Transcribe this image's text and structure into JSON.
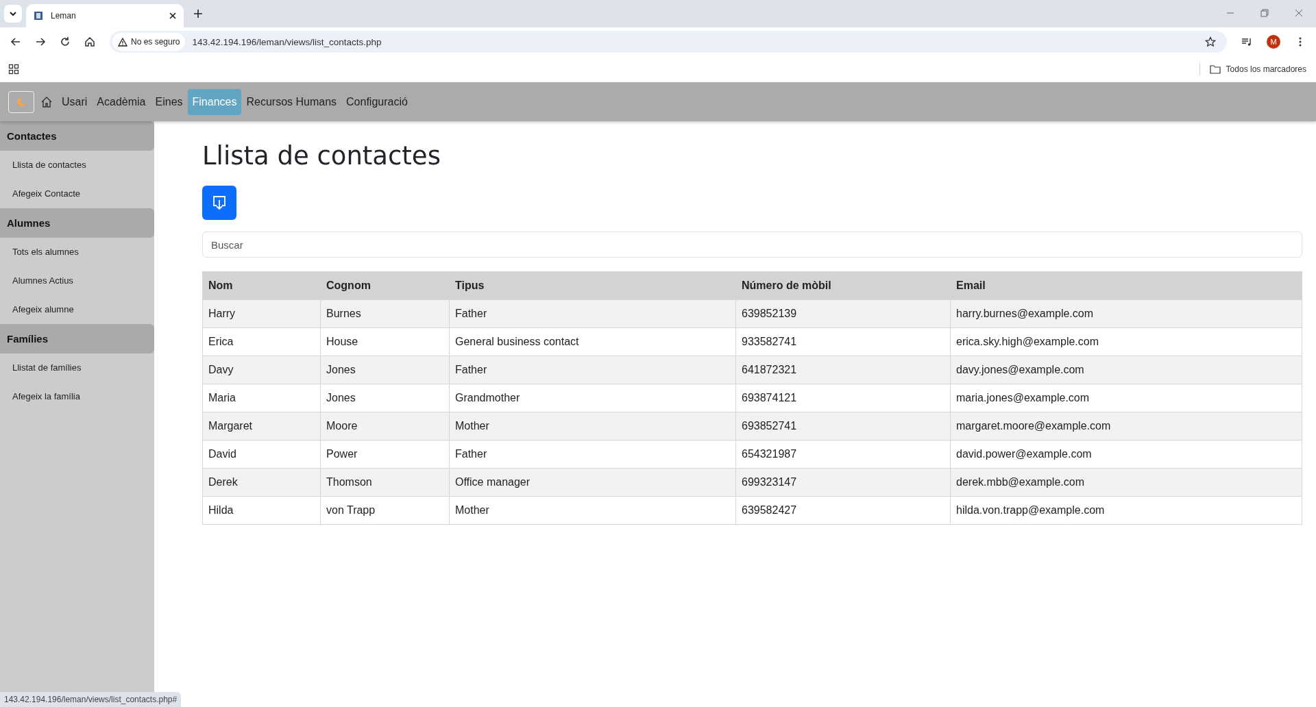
{
  "browser": {
    "tab": {
      "title": "Leman"
    },
    "security": "No es seguro",
    "url": "143.42.194.196/leman/views/list_contacts.php",
    "profile_initial": "M",
    "bookmarks_folder": "Todos los marcadores"
  },
  "navbar": {
    "items": [
      {
        "label": "Usari",
        "selected": false
      },
      {
        "label": "Acadèmia",
        "selected": false
      },
      {
        "label": "Eines",
        "selected": false
      },
      {
        "label": "Finances",
        "selected": true
      },
      {
        "label": "Recursos Humans",
        "selected": false
      },
      {
        "label": "Configuració",
        "selected": false
      }
    ]
  },
  "sidebar": {
    "sections": [
      {
        "title": "Contactes",
        "items": [
          "Llista de contactes",
          "Afegeix Contacte"
        ]
      },
      {
        "title": "Alumnes",
        "items": [
          "Tots els alumnes",
          "Alumnes Actius",
          "Afegeix alumne"
        ]
      },
      {
        "title": "Famílies",
        "items": [
          "Llistat de famílies",
          "Afegeix la família"
        ]
      }
    ]
  },
  "page": {
    "title": "Llista de contactes",
    "search": {
      "placeholder": "Buscar"
    }
  },
  "table": {
    "columns": [
      "Nom",
      "Cognom",
      "Tipus",
      "Número de mòbil",
      "Email"
    ],
    "rows": [
      [
        "Harry",
        "Burnes",
        "Father",
        "639852139",
        "harry.burnes@example.com"
      ],
      [
        "Erica",
        "House",
        "General business contact",
        "933582741",
        "erica.sky.high@example.com"
      ],
      [
        "Davy",
        "Jones",
        "Father",
        "641872321",
        "davy.jones@example.com"
      ],
      [
        "Maria",
        "Jones",
        "Grandmother",
        "693874121",
        "maria.jones@example.com"
      ],
      [
        "Margaret",
        "Moore",
        "Mother",
        "693852741",
        "margaret.moore@example.com"
      ],
      [
        "David",
        "Power",
        "Father",
        "654321987",
        "david.power@example.com"
      ],
      [
        "Derek",
        "Thomson",
        "Office manager",
        "699323147",
        "derek.mbb@example.com"
      ],
      [
        "Hilda",
        "von Trapp",
        "Mother",
        "639582427",
        "hilda.von.trapp@example.com"
      ]
    ]
  },
  "status_bar": "143.42.194.196/leman/views/list_contacts.php#"
}
